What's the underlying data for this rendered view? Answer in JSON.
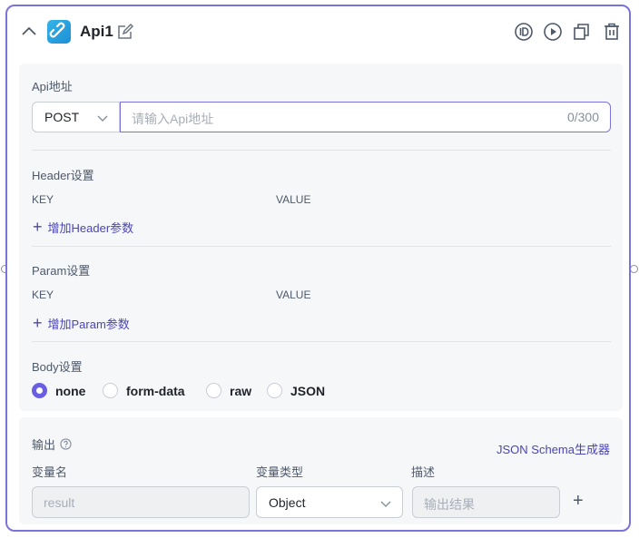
{
  "node": {
    "title": "Api1",
    "icons": {
      "collapse": "chevron-up-icon",
      "type": "link-icon",
      "edit": "edit-icon",
      "id": "id-icon",
      "run": "play-icon",
      "copy": "copy-icon",
      "delete": "trash-icon"
    },
    "accent_color": "#7b73dc"
  },
  "api": {
    "address_label": "Api地址",
    "method": "POST",
    "url_placeholder": "请输入Api地址",
    "url_counter": "0/300"
  },
  "headers": {
    "section_label": "Header设置",
    "key_label": "KEY",
    "value_label": "VALUE",
    "add_label": "增加Header参数"
  },
  "params": {
    "section_label": "Param设置",
    "key_label": "KEY",
    "value_label": "VALUE",
    "add_label": "增加Param参数"
  },
  "body": {
    "section_label": "Body设置",
    "options": [
      "none",
      "form-data",
      "raw",
      "JSON"
    ],
    "selected": "none"
  },
  "output": {
    "section_label": "输出",
    "schema_link": "JSON Schema生成器",
    "col_name": "变量名",
    "col_type": "变量类型",
    "col_desc": "描述",
    "var_name": "result",
    "var_type": "Object",
    "var_desc_placeholder": "输出结果",
    "add_row": "+"
  }
}
